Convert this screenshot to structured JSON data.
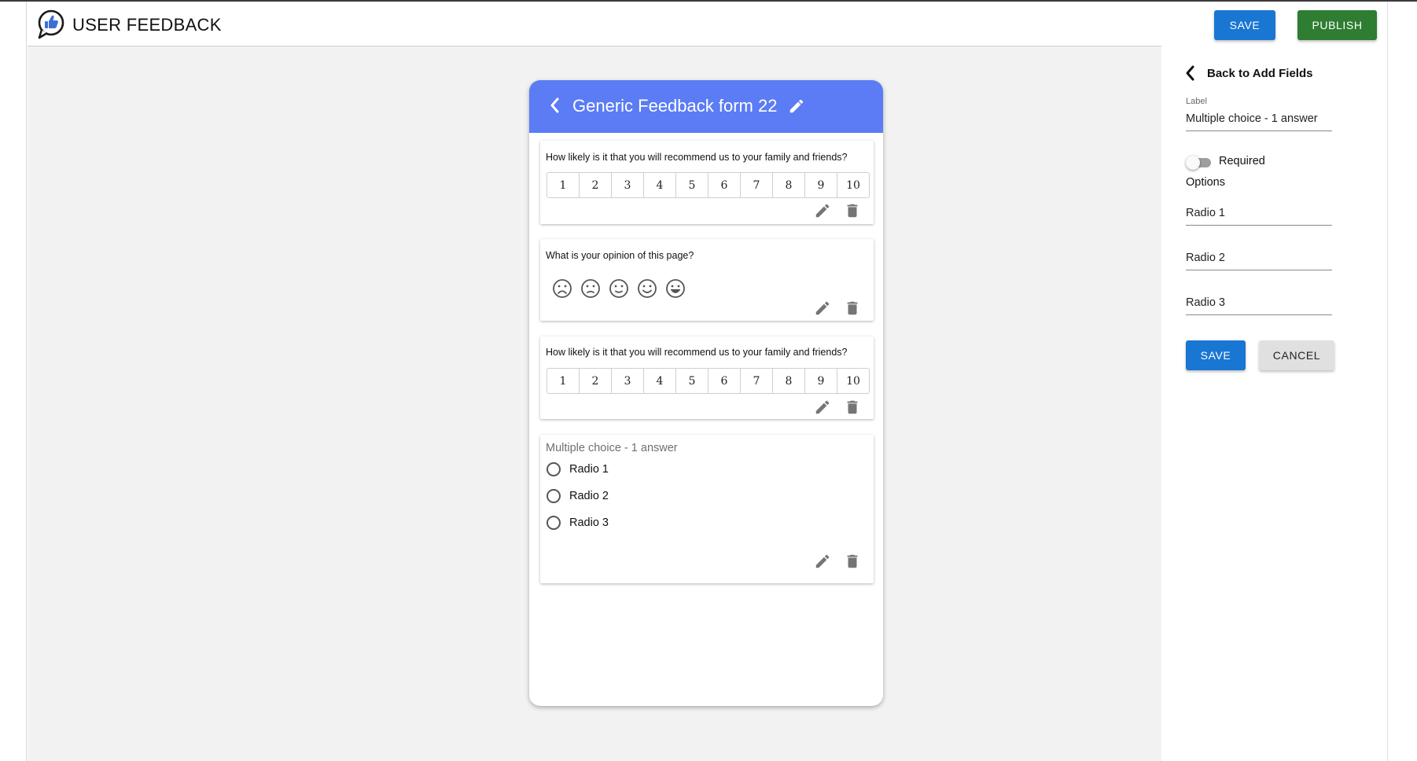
{
  "app": {
    "title": "USER FEEDBACK",
    "logo_icon": "thumbs-up-chat-icon",
    "save_label": "SAVE",
    "publish_label": "PUBLISH"
  },
  "colors": {
    "primary": "#1976d2",
    "publish": "#2e7d32",
    "form_header": "#5b7cf4",
    "canvas": "#f2f2f2"
  },
  "form": {
    "title": "Generic Feedback form 22",
    "questions": [
      {
        "type": "nps",
        "text": "How likely is it that you will recommend us to your family and friends?",
        "scale": [
          "1",
          "2",
          "3",
          "4",
          "5",
          "6",
          "7",
          "8",
          "9",
          "10"
        ]
      },
      {
        "type": "smiley",
        "text": "What is your opinion of this page?",
        "faces": [
          "very-sad-face-icon",
          "sad-face-icon",
          "neutral-face-icon",
          "happy-face-icon",
          "very-happy-face-icon"
        ]
      },
      {
        "type": "nps",
        "text": "How likely is it that you will recommend us to your family and friends?",
        "scale": [
          "1",
          "2",
          "3",
          "4",
          "5",
          "6",
          "7",
          "8",
          "9",
          "10"
        ]
      },
      {
        "type": "multiple_choice",
        "label": "Multiple choice - 1 answer",
        "options": [
          "Radio 1",
          "Radio 2",
          "Radio 3"
        ]
      }
    ]
  },
  "panel": {
    "back_label": "Back to Add Fields",
    "label_caption": "Label",
    "label_value": "Multiple choice - 1 answer",
    "required_label": "Required",
    "required_on": false,
    "options_heading": "Options",
    "options": [
      "Radio 1",
      "Radio 2",
      "Radio 3"
    ],
    "save_label": "SAVE",
    "cancel_label": "CANCEL"
  }
}
